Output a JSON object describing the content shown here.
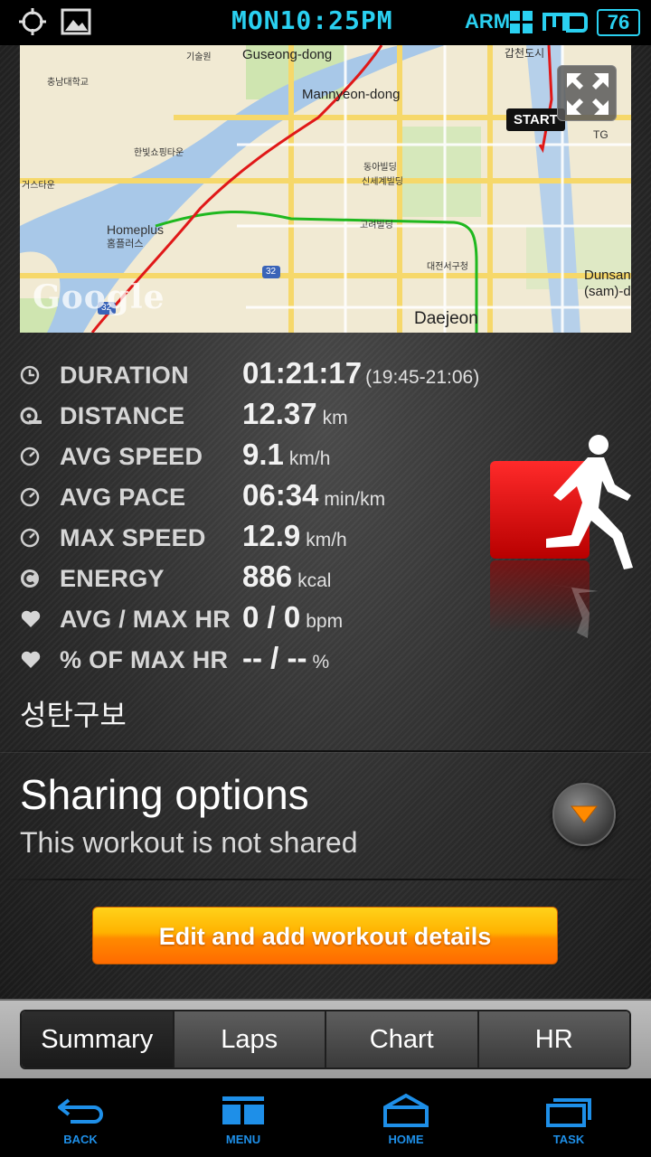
{
  "status_bar": {
    "time": "MON10:25PM",
    "arm_label": "ARM",
    "battery": "76",
    "icons": [
      "gps-icon",
      "image-icon",
      "grid-icon",
      "md-icon"
    ]
  },
  "map": {
    "start_label": "START",
    "google_logo": "Google",
    "labels": {
      "guseong": "Guseong-dong",
      "mannyeon": "Mannyeon-dong",
      "homeplus": "Homeplus",
      "homeplus_kr": "홈플러스",
      "daejeon": "Daejeon",
      "dunsan": "Dunsan",
      "dunsan2": "(sam)-do",
      "tg": "TG",
      "road_32a": "32",
      "road_32b": "32",
      "kr1": "기술원",
      "kr2": "충남대학교",
      "kr3": "한빛쇼핑타운",
      "kr4": "거스타운",
      "kr5": "대전서구청",
      "kr6": "갑천도시",
      "kr7": "고려빌딩",
      "kr8": "동아빌딩",
      "kr9": "신세계빌딩"
    }
  },
  "stats": [
    {
      "icon": "clock-icon",
      "label": "DURATION",
      "value": "01:21:17",
      "unit": "",
      "sub": "(19:45-21:06)"
    },
    {
      "icon": "distance-icon",
      "label": "DISTANCE",
      "value": "12.37",
      "unit": "km",
      "sub": ""
    },
    {
      "icon": "speedometer-icon",
      "label": "AVG SPEED",
      "value": "9.1",
      "unit": "km/h",
      "sub": ""
    },
    {
      "icon": "speedometer-icon",
      "label": "AVG PACE",
      "value": "06:34",
      "unit": "min/km",
      "sub": ""
    },
    {
      "icon": "speedometer-icon",
      "label": "MAX SPEED",
      "value": "12.9",
      "unit": "km/h",
      "sub": ""
    },
    {
      "icon": "energy-icon",
      "label": "ENERGY",
      "value": "886",
      "unit": "kcal",
      "sub": ""
    },
    {
      "icon": "heart-icon",
      "label": "AVG / MAX HR",
      "value": "0 / 0",
      "unit": "bpm",
      "sub": ""
    },
    {
      "icon": "heart-icon",
      "label": "% OF MAX HR",
      "value": "-- / --",
      "unit": "%",
      "sub": ""
    }
  ],
  "activity_name": "성탄구보",
  "sharing": {
    "title": "Sharing options",
    "subtitle": "This workout is not shared"
  },
  "edit_button": "Edit and add workout details",
  "tabs": [
    {
      "label": "Summary",
      "active": true
    },
    {
      "label": "Laps",
      "active": false
    },
    {
      "label": "Chart",
      "active": false
    },
    {
      "label": "HR",
      "active": false
    }
  ],
  "nav": {
    "back": "BACK",
    "menu": "MENU",
    "home": "HOME",
    "task": "TASK"
  },
  "colors": {
    "accent": "#2ad0f0",
    "route": "#e01818",
    "button_top": "#ffd21a",
    "button_bottom": "#ff6b00",
    "nav_blue": "#1e8fe8"
  }
}
